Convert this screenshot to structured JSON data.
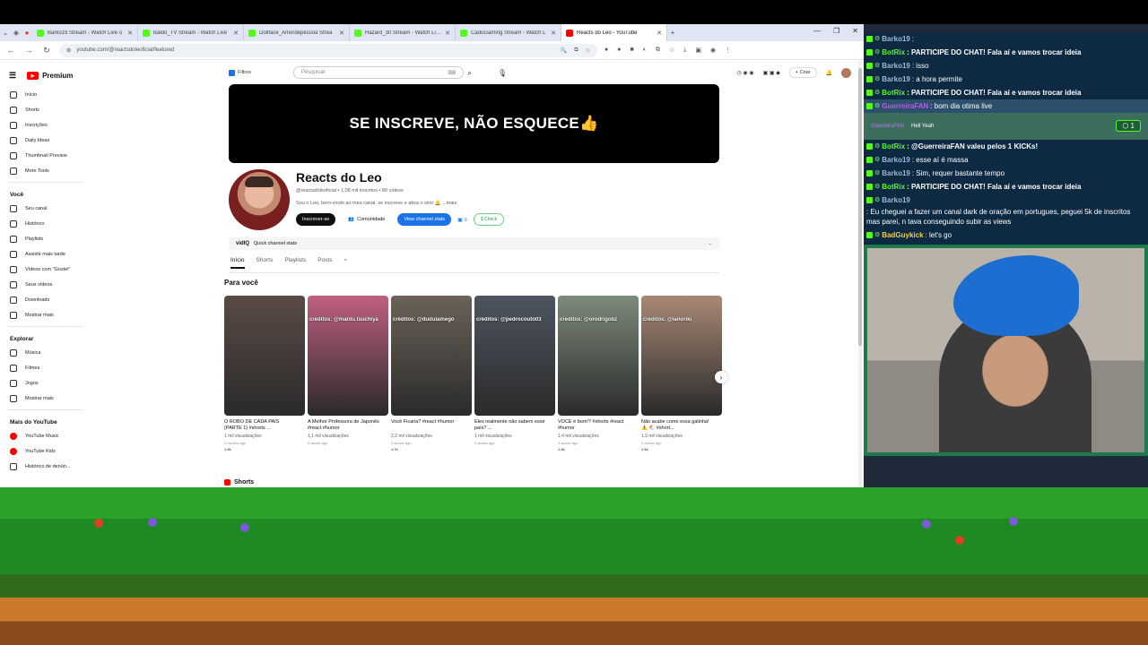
{
  "browser": {
    "tabs": [
      {
        "label": "Barko19 Stream - Watch Live o"
      },
      {
        "label": "Baldo_TV Stream - Watch Live"
      },
      {
        "label": "Dollface_Amordepessoa Strea"
      },
      {
        "label": "Hazard_30 Stream - Watch Live"
      },
      {
        "label": "CaduGaming Stream - Watch L"
      },
      {
        "label": "Reacts do Leo - YouTube"
      }
    ],
    "new_tab": "+",
    "url": "youtube.com/@reactsdoleoficial/featured"
  },
  "youtube": {
    "logo": "Premium",
    "sidebar": {
      "main": [
        {
          "label": "Início"
        },
        {
          "label": "Shorts"
        },
        {
          "label": "Inscrições"
        },
        {
          "label": "Daily Ideas"
        },
        {
          "label": "Thumbnail Preview"
        },
        {
          "label": "More Tools"
        }
      ],
      "voce_title": "Você",
      "voce": [
        {
          "label": "Seu canal"
        },
        {
          "label": "Histórico"
        },
        {
          "label": "Playlists"
        },
        {
          "label": "Assistir mais tarde"
        },
        {
          "label": "Vídeos com \"Gostei\""
        },
        {
          "label": "Seus vídeos"
        },
        {
          "label": "Downloads"
        },
        {
          "label": "Mostrar mais"
        }
      ],
      "explorar_title": "Explorar",
      "explorar": [
        {
          "label": "Música"
        },
        {
          "label": "Filmes"
        },
        {
          "label": "Jogos"
        },
        {
          "label": "Mostrar mais"
        }
      ],
      "mais_title": "Mais do YouTube",
      "mais": [
        {
          "label": "YouTube Music"
        },
        {
          "label": "YouTube Kids"
        },
        {
          "label": "Histórico de denún..."
        }
      ]
    },
    "filtros": "Filtros",
    "search_placeholder": "Pesquisar",
    "criar": "+ Criar",
    "banner_text": "SE INSCREVE, NÃO ESQUECE👍",
    "channel": {
      "name": "Reacts do Leo",
      "meta": "@reactsdoleoficial • 1,08 mil inscritos • 80 vídeos",
      "description": "Sou o Leo, bem-vindo ao meu canal, se inscreve e ativa o sino 🔔 ...mais",
      "subscribe": "Inscrever-se",
      "community": "Comunidade",
      "stats": "View channel stats",
      "check": "$ Check"
    },
    "vidiq": {
      "brand": "vidIQ",
      "label": "Quick channel stats"
    },
    "channel_tabs": [
      "Início",
      "Shorts",
      "Playlists",
      "Posts"
    ],
    "section_title": "Para você",
    "videos": [
      {
        "caption": "",
        "title": "O ROBÔ DE CADA PAÍS (PARTE 1) #shorts ...",
        "views": "1 mil visualizações",
        "ago": "2 months ago",
        "badge": "1.9k",
        "color": "#5a4a44"
      },
      {
        "caption": "créditos: @marilu.tsuchiya",
        "title": "A Melhor Professora de Japonês #react #humor",
        "views": "1,1 mil visualizações",
        "ago": "2 weeks ago",
        "badge": "",
        "color": "#c06080"
      },
      {
        "caption": "créditos: @dudulamego",
        "title": "Você Ficaria? #react #humor",
        "views": "2,2 mil visualizações",
        "ago": "2 weeks ago",
        "badge": "1.7k",
        "color": "#6b6258"
      },
      {
        "caption": "créditos: @pedrocouto03",
        "title": "Eles realmente não sabem esse país? ...",
        "views": "1 mil visualizações",
        "ago": "2 weeks ago",
        "badge": "",
        "color": "#4e5560"
      },
      {
        "caption": "créditos: @orodrigobz",
        "title": "VOCÊ é bom!? #shorts #react #humor",
        "views": "1,4 mil visualizações",
        "ago": "2 weeks ago",
        "badge": "1.3k",
        "color": "#7d8a7a"
      },
      {
        "caption": "créditos: @ianoriki",
        "title": "Não acabe como essa galinha! ⚠️ 🐔 #short...",
        "views": "1,9 mil visualizações",
        "ago": "2 weeks ago",
        "badge": "1.6k",
        "color": "#a88874"
      }
    ],
    "shorts_title": "Shorts"
  },
  "chat": {
    "messages": [
      {
        "user": "Barko19",
        "text": ":",
        "color": "#9fb8d8",
        "bold": false
      },
      {
        "user": "BotRix",
        "text": ": PARTICIPE DO CHAT! Fala aí e vamos trocar ideia",
        "color": "#53fc18",
        "bold": true
      },
      {
        "user": "Barko19",
        "text": ": isso",
        "color": "#9fb8d8",
        "bold": false
      },
      {
        "user": "Barko19",
        "text": ": a hora permite",
        "color": "#9fb8d8",
        "bold": false
      },
      {
        "user": "BotRix",
        "text": ": PARTICIPE DO CHAT! Fala aí e vamos trocar ideia",
        "color": "#53fc18",
        "bold": true
      },
      {
        "user": "GuerreiraFAN",
        "text": ": bom dia otima live",
        "color": "#b060e0",
        "bold": false
      }
    ],
    "kick_user": "GuerreiraFAN",
    "kick_text": "Hell Yeah",
    "kick_count": "1",
    "messages2": [
      {
        "user": "BotRix",
        "text": ": @GuerreiraFAN valeu pelos 1 KICKs!",
        "color": "#53fc18",
        "bold": true
      },
      {
        "user": "Barko19",
        "text": ": esse aí é massa",
        "color": "#9fb8d8",
        "bold": false
      },
      {
        "user": "Barko19",
        "text": ": Sim, requer bastante tempo",
        "color": "#9fb8d8",
        "bold": false
      },
      {
        "user": "BotRix",
        "text": ": PARTICIPE DO CHAT! Fala aí e vamos trocar ideia",
        "color": "#53fc18",
        "bold": true
      },
      {
        "user": "Barko19",
        "text": ": Eu cheguei a fazer um canal dark de oração em portugues, peguei 5k de inscritos mas parei, n tava conseguindo subir as views",
        "color": "#9fb8d8",
        "bold": false
      },
      {
        "user": "BadGuykick",
        "text": ": let's go",
        "color": "#f0d040",
        "bold": false
      }
    ]
  }
}
